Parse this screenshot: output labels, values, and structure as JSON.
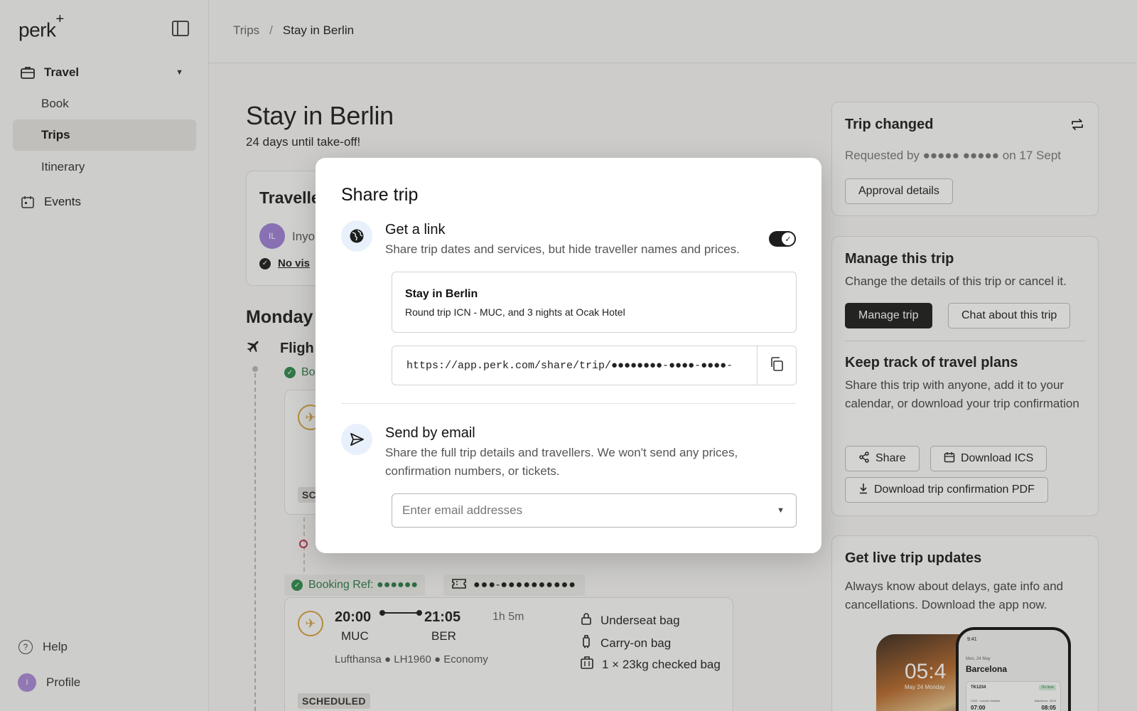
{
  "app": {
    "logo": "perk",
    "logo_mark": "+"
  },
  "sidebar": {
    "travel_label": "Travel",
    "sub_items": [
      {
        "label": "Book"
      },
      {
        "label": "Trips"
      },
      {
        "label": "Itinerary"
      }
    ],
    "events_label": "Events",
    "help_label": "Help",
    "profile_label": "Profile",
    "profile_initial": "I"
  },
  "breadcrumb": {
    "root": "Trips",
    "separator": "/",
    "current": "Stay in Berlin"
  },
  "page": {
    "title": "Stay in Berlin",
    "subtitle": "24 days until take-off!"
  },
  "travellers": {
    "title": "Travelle",
    "initials": "IL",
    "name": "Inyo",
    "visa_text": "No vis"
  },
  "itinerary": {
    "day_title": "Monday",
    "flight_label": "Fligh",
    "booking_top": "Bo",
    "card1_status": "SC",
    "booking_ref": "Booking Ref: ●●●●●●",
    "ticket_number": "●●●-●●●●●●●●●●",
    "flight": {
      "dep_time": "20:00",
      "dep_code": "MUC",
      "arr_time": "21:05",
      "arr_code": "BER",
      "duration": "1h 5m",
      "meta": "Lufthansa ● LH1960 ● Economy",
      "status": "SCHEDULED",
      "bags": [
        "Underseat bag",
        "Carry-on bag",
        "1 × 23kg checked bag"
      ]
    }
  },
  "trip_changed": {
    "title": "Trip changed",
    "requested": "Requested by ●●●●● ●●●●● on 17 Sept",
    "button": "Approval details"
  },
  "manage": {
    "title": "Manage this trip",
    "text": "Change the details of this trip or cancel it.",
    "manage_button": "Manage trip",
    "chat_button": "Chat about this trip",
    "track_title": "Keep track of travel plans",
    "track_text": "Share this trip with anyone, add it to your calendar, or download your trip confirmation",
    "share_button": "Share",
    "ics_button": "Download ICS",
    "pdf_button": "Download trip confirmation PDF"
  },
  "live": {
    "title": "Get live trip updates",
    "text": "Always know about delays, gate info and cancellations. Download the app now.",
    "phone_time": "05:4",
    "phone_date": "May 24  Monday",
    "phone2_status_time": "9:41",
    "phone2_date": "Mon, 24 May",
    "phone2_city": "Barcelona",
    "phone2_flight": "TK1234",
    "phone2_on_time": "On time",
    "phone2_route_left": "LGW - London Gatwick",
    "phone2_route_right": "Barcelona - BCN",
    "phone2_dep": "07:00",
    "phone2_arr": "08:05"
  },
  "modal": {
    "title": "Share trip",
    "link_title": "Get a link",
    "link_desc": "Share trip dates and services, but hide traveller names and prices.",
    "link_enabled": true,
    "preview_title": "Stay in Berlin",
    "preview_sub": "Round trip ICN - MUC, and 3 nights at Ocak Hotel",
    "share_url": "https://app.perk.com/share/trip/●●●●●●●●-●●●●-●●●●-",
    "email_title": "Send by email",
    "email_desc": "Share the full trip details and travellers. We won't send any prices, confirmation numbers, or tickets.",
    "email_placeholder": "Enter email addresses"
  },
  "colors": {
    "accent_dark": "#1d1d1d",
    "success": "#2e8b4c",
    "lufthansa": "#d7a13f",
    "avatar": "#a989d6"
  }
}
